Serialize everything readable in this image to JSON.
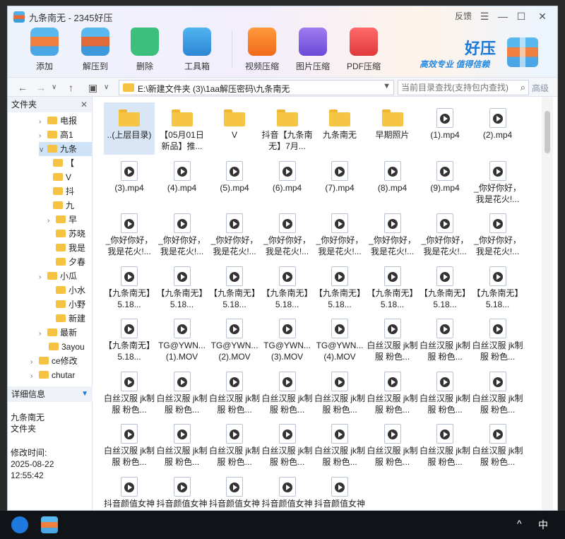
{
  "window": {
    "title": "九条南无 - 2345好压",
    "feedback": "反馈",
    "menu_icon": "menu-icon",
    "min_icon": "minimize-icon",
    "max_icon": "maximize-icon",
    "close_icon": "close-icon"
  },
  "toolbar": {
    "add": "添加",
    "extract_to": "解压到",
    "delete": "删除",
    "toolbox": "工具箱",
    "video_compress": "视频压缩",
    "image_compress": "图片压缩",
    "pdf_compress": "PDF压缩"
  },
  "brand": {
    "name": "好压",
    "slogan": "高效专业 值得信赖"
  },
  "address": {
    "path": "E:\\新建文件夹 (3)\\1aa解压密码\\九条南无",
    "search_placeholder": "当前目录查找(支持包内查找)",
    "advanced": "高级"
  },
  "sidebar": {
    "header": "文件夹",
    "tree": [
      {
        "label": "电报"
      },
      {
        "label": "高1"
      },
      {
        "label": "九条"
      },
      {
        "label": "【"
      },
      {
        "label": "V"
      },
      {
        "label": "抖"
      },
      {
        "label": "九"
      },
      {
        "label": "早"
      },
      {
        "label": "苏晓"
      },
      {
        "label": "我是"
      },
      {
        "label": "夕春"
      },
      {
        "label": "小瓜"
      },
      {
        "label": "小水"
      },
      {
        "label": "小野"
      },
      {
        "label": "新建"
      },
      {
        "label": "最新"
      },
      {
        "label": "3ayou"
      },
      {
        "label": "ce修改"
      },
      {
        "label": "chutar"
      }
    ]
  },
  "details": {
    "header": "详细信息",
    "name": "九条南无",
    "type": "文件夹",
    "modified_label": "修改时间:",
    "modified_date": "2025-08-22",
    "modified_time": "12:55:42"
  },
  "files": [
    {
      "name": "..(上层目录)",
      "kind": "folder"
    },
    {
      "name": "【05月01日新品】推...",
      "kind": "folder"
    },
    {
      "name": "V",
      "kind": "folder"
    },
    {
      "name": "抖音【九条南无】7月...",
      "kind": "folder"
    },
    {
      "name": "九条南无",
      "kind": "folder"
    },
    {
      "name": "早期照片",
      "kind": "folder"
    },
    {
      "name": "(1).mp4",
      "kind": "video"
    },
    {
      "name": "(2).mp4",
      "kind": "video"
    },
    {
      "name": "(3).mp4",
      "kind": "video"
    },
    {
      "name": "(4).mp4",
      "kind": "video"
    },
    {
      "name": "(5).mp4",
      "kind": "video"
    },
    {
      "name": "(6).mp4",
      "kind": "video"
    },
    {
      "name": "(7).mp4",
      "kind": "video"
    },
    {
      "name": "(8).mp4",
      "kind": "video"
    },
    {
      "name": "(9).mp4",
      "kind": "video"
    },
    {
      "name": "_你好你好，我是花火!...",
      "kind": "video"
    },
    {
      "name": "_你好你好，我是花火!...",
      "kind": "video"
    },
    {
      "name": "_你好你好，我是花火!...",
      "kind": "video"
    },
    {
      "name": "_你好你好，我是花火!...",
      "kind": "video"
    },
    {
      "name": "_你好你好，我是花火!...",
      "kind": "video"
    },
    {
      "name": "_你好你好，我是花火!...",
      "kind": "video"
    },
    {
      "name": "_你好你好，我是花火!...",
      "kind": "video"
    },
    {
      "name": "_你好你好，我是花火!...",
      "kind": "video"
    },
    {
      "name": "_你好你好，我是花火!...",
      "kind": "video"
    },
    {
      "name": "【九条南无】5.18...",
      "kind": "video"
    },
    {
      "name": "【九条南无】5.18...",
      "kind": "video"
    },
    {
      "name": "【九条南无】5.18...",
      "kind": "video"
    },
    {
      "name": "【九条南无】5.18...",
      "kind": "video"
    },
    {
      "name": "【九条南无】5.18...",
      "kind": "video"
    },
    {
      "name": "【九条南无】5.18...",
      "kind": "video"
    },
    {
      "name": "【九条南无】5.18...",
      "kind": "video"
    },
    {
      "name": "【九条南无】5.18...",
      "kind": "video"
    },
    {
      "name": "【九条南无】5.18...",
      "kind": "video"
    },
    {
      "name": "TG@YWN...(1).MOV",
      "kind": "video"
    },
    {
      "name": "TG@YWN...(2).MOV",
      "kind": "video"
    },
    {
      "name": "TG@YWN...(3).MOV",
      "kind": "video"
    },
    {
      "name": "TG@YWN...(4).MOV",
      "kind": "video"
    },
    {
      "name": "白丝汉服 jk制服 粉色...",
      "kind": "video"
    },
    {
      "name": "白丝汉服 jk制服 粉色...",
      "kind": "video"
    },
    {
      "name": "白丝汉服 jk制服 粉色...",
      "kind": "video"
    },
    {
      "name": "白丝汉服 jk制服 粉色...",
      "kind": "video"
    },
    {
      "name": "白丝汉服 jk制服 粉色...",
      "kind": "video"
    },
    {
      "name": "白丝汉服 jk制服 粉色...",
      "kind": "video"
    },
    {
      "name": "白丝汉服 jk制服 粉色...",
      "kind": "video"
    },
    {
      "name": "白丝汉服 jk制服 粉色...",
      "kind": "video"
    },
    {
      "name": "白丝汉服 jk制服 粉色...",
      "kind": "video"
    },
    {
      "name": "白丝汉服 jk制服 粉色...",
      "kind": "video"
    },
    {
      "name": "白丝汉服 jk制服 粉色...",
      "kind": "video"
    },
    {
      "name": "白丝汉服 jk制服 粉色...",
      "kind": "video"
    },
    {
      "name": "白丝汉服 jk制服 粉色...",
      "kind": "video"
    },
    {
      "name": "白丝汉服 jk制服 粉色...",
      "kind": "video"
    },
    {
      "name": "白丝汉服 jk制服 粉色...",
      "kind": "video"
    },
    {
      "name": "白丝汉服 jk制服 粉色...",
      "kind": "video"
    },
    {
      "name": "白丝汉服 jk制服 粉色...",
      "kind": "video"
    },
    {
      "name": "白丝汉服 jk制服 粉色...",
      "kind": "video"
    },
    {
      "name": "白丝汉服 jk制服 粉色...",
      "kind": "video"
    },
    {
      "name": "抖音颜值女神 九条南...",
      "kind": "video"
    },
    {
      "name": "抖音颜值女神 九条南...",
      "kind": "video"
    },
    {
      "name": "抖音颜值女神 九条南...",
      "kind": "video"
    },
    {
      "name": "抖音颜值女神 九条南...",
      "kind": "video"
    },
    {
      "name": "抖音颜值女神 九条南...",
      "kind": "video"
    }
  ],
  "taskbar": {
    "caret": "^",
    "ime": "中"
  }
}
